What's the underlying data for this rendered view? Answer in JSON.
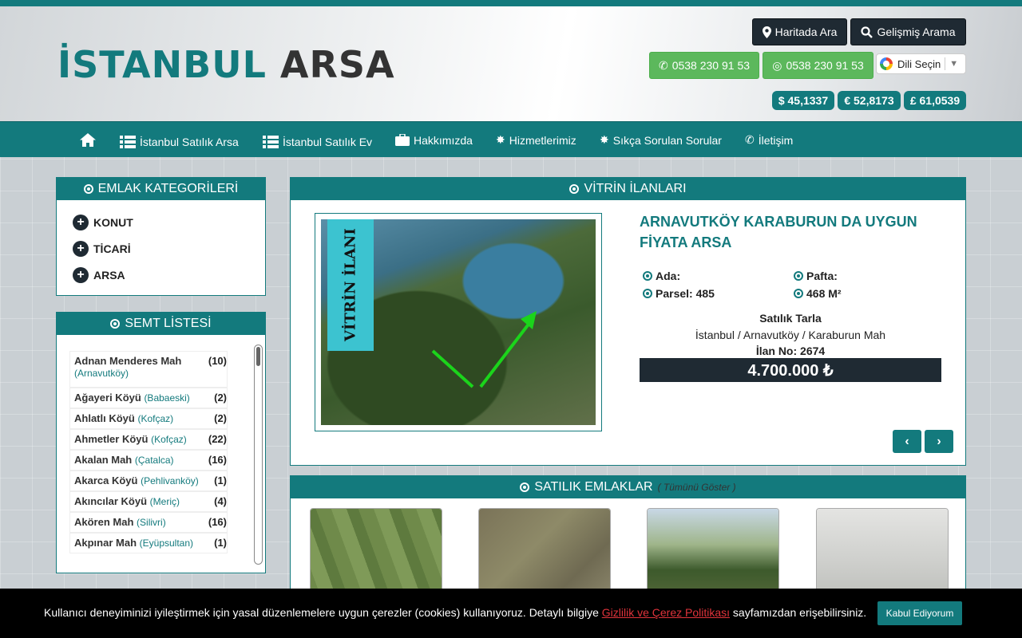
{
  "logo": {
    "part1": "İSTANBUL",
    "part2": "ARSA"
  },
  "header": {
    "map_search": "Haritada Ara",
    "advanced_search": "Gelişmiş Arama",
    "phone": "0538 230 91 53",
    "whatsapp": "0538 230 91 53",
    "language": "Dili Seçin",
    "rates": {
      "usd": "$ 45,1337",
      "eur": "€ 52,8173",
      "gbp": "£ 61,0539"
    }
  },
  "nav": {
    "items": [
      {
        "label": "İstanbul Satılık Arsa"
      },
      {
        "label": "İstanbul Satılık Ev"
      },
      {
        "label": "Hakkımızda"
      },
      {
        "label": "Hizmetlerimiz"
      },
      {
        "label": "Sıkça Sorulan Sorular"
      },
      {
        "label": "İletişim"
      }
    ]
  },
  "categories": {
    "title": "EMLAK KATEGORİLERİ",
    "items": [
      "KONUT",
      "TİCARİ",
      "ARSA"
    ]
  },
  "semt": {
    "title": "SEMT LİSTESİ",
    "items": [
      {
        "name": "Adnan Menderes Mah",
        "district": "(Arnavutköy)",
        "count": "(10)"
      },
      {
        "name": "Ağayeri Köyü",
        "district": "(Babaeski)",
        "count": "(2)"
      },
      {
        "name": "Ahlatlı Köyü",
        "district": "(Kofçaz)",
        "count": "(2)"
      },
      {
        "name": "Ahmetler Köyü",
        "district": "(Kofçaz)",
        "count": "(22)"
      },
      {
        "name": "Akalan Mah",
        "district": "(Çatalca)",
        "count": "(16)"
      },
      {
        "name": "Akarca Köyü",
        "district": "(Pehlivanköy)",
        "count": "(1)"
      },
      {
        "name": "Akıncılar Köyü",
        "district": "(Meriç)",
        "count": "(4)"
      },
      {
        "name": "Akören Mah",
        "district": "(Silivri)",
        "count": "(16)"
      },
      {
        "name": "Akpınar Mah",
        "district": "(Eyüpsultan)",
        "count": "(1)"
      }
    ]
  },
  "vitrin": {
    "title": "VİTRİN İLANLARI",
    "ribbon": "VİTRİN İLANI",
    "listing_title": "ARNAVUTKÖY KARABURUN DA UYGUN FİYATA ARSA",
    "ada_label": "Ada:",
    "pafta_label": "Pafta:",
    "parsel": "Parsel: 485",
    "area": "468 M²",
    "type": "Satılık Tarla",
    "location": "İstanbul / Arnavutköy / Karaburun Mah",
    "ilan_no": "İlan No: 2674",
    "price": "4.700.000 ₺"
  },
  "satilik": {
    "title": "SATILIK EMLAKLAR",
    "show_all": "( Tümünü Göster )"
  },
  "cookie": {
    "text_before": "Kullanıcı deneyiminizi iyileştirmek için yasal düzenlemelere uygun çerezler (cookies) kullanıyoruz. Detaylı bilgiye",
    "link": "Gizlilik ve Çerez Politikası",
    "text_after": "sayfamızdan erişebilirsiniz.",
    "accept": "Kabul Ediyorum"
  },
  "colors": {
    "primary": "#137a7d",
    "dark": "#1f2a33",
    "green": "#5cb85c"
  }
}
